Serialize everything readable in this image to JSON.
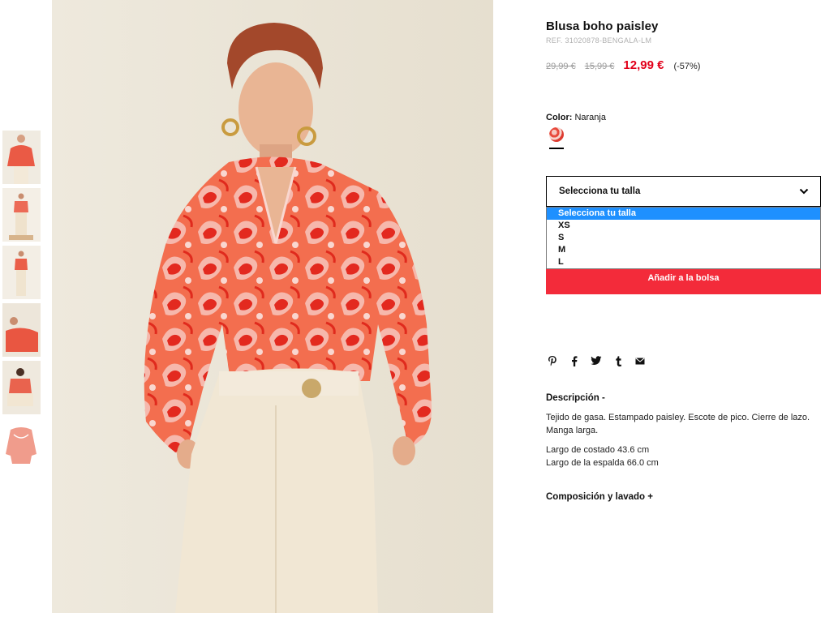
{
  "product": {
    "title": "Blusa boho paisley",
    "ref": "REF. 31020878-BENGALA-LM",
    "price_original": "29,99 €",
    "price_previous": "15,99 €",
    "price_sale": "12,99 €",
    "discount": "(-57%)",
    "sale_color": "#e2001a"
  },
  "color": {
    "label": "Color:",
    "value": "Naranja"
  },
  "size": {
    "select_label": "Selecciona tu talla",
    "options": [
      "Selecciona tu talla",
      "XS",
      "S",
      "M",
      "L"
    ],
    "selected_index": 0
  },
  "add_to_bag": {
    "label": "Añadir a la bolsa",
    "color": "#f32b3a"
  },
  "share_icons": [
    "pinterest-icon",
    "facebook-icon",
    "twitter-icon",
    "tumblr-icon",
    "email-icon"
  ],
  "description": {
    "heading": "Descripción -",
    "text": "Tejido de gasa. Estampado paisley. Escote de pico. Cierre de lazo. Manga larga.",
    "measure_1": "Largo de costado 43.6 cm",
    "measure_2": "Largo de la espalda 66.0 cm"
  },
  "composition": {
    "heading": "Composición y lavado +"
  },
  "gallery": {
    "thumbnail_count": 6,
    "selected_thumbnail": 0
  }
}
